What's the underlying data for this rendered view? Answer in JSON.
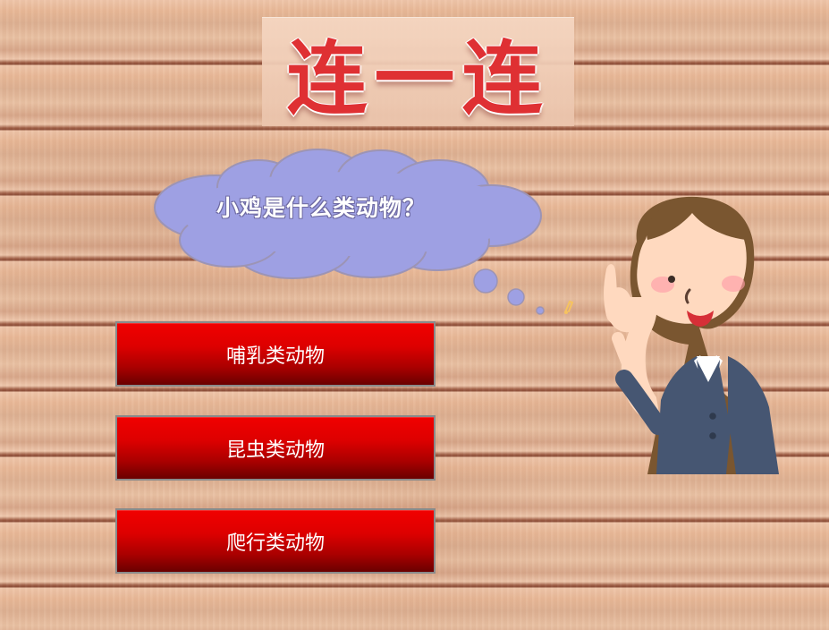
{
  "game": {
    "title": "连一连",
    "question": "小鸡是什么类动物？",
    "answers": [
      "哺乳类动物",
      "昆虫类动物",
      "爬行类动物"
    ]
  },
  "colors": {
    "wood_light": "#efc6aa",
    "wood_dark": "#8b4d38",
    "title_red": "#df3033",
    "cloud": "#9ea0e3",
    "answer_red": "#d90000",
    "answer_border": "#8a8a8a",
    "teacher_suit": "#465672",
    "teacher_skin": "#ffd9bf",
    "teacher_hair": "#7a5630"
  },
  "icons": {
    "title_decoration": "title-text",
    "character": "teacher-icon",
    "speech": "cloud-icon"
  }
}
